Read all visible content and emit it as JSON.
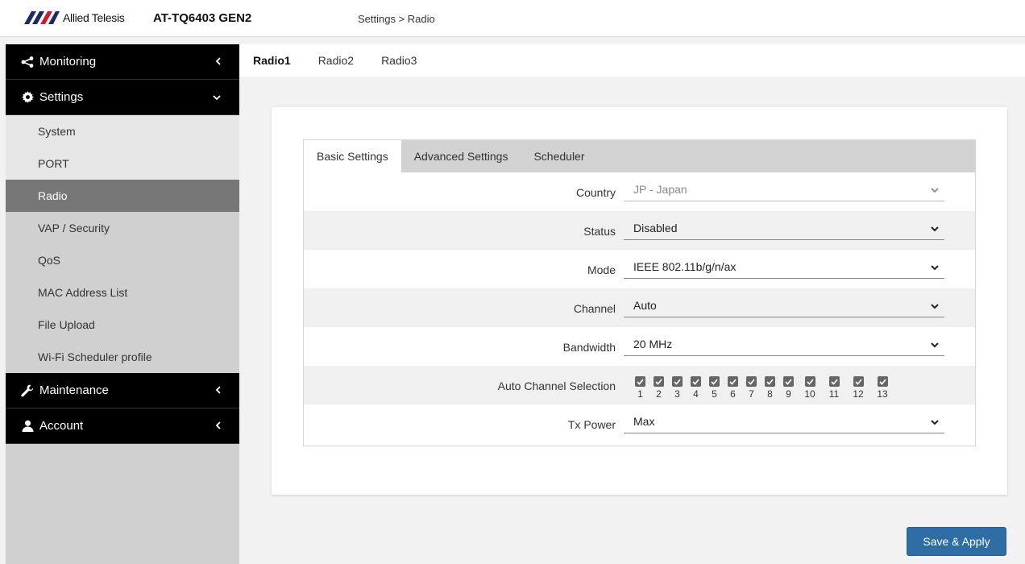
{
  "header": {
    "brand": "Allied Telesis",
    "model": "AT-TQ6403 GEN2",
    "breadcrumb": "Settings > Radio"
  },
  "sidebar": {
    "groups": [
      {
        "label": "Monitoring",
        "icon": "share-icon",
        "state": "collapsed"
      },
      {
        "label": "Settings",
        "icon": "gear-icon",
        "state": "expanded"
      },
      {
        "label": "Maintenance",
        "icon": "wrench-icon",
        "state": "collapsed"
      },
      {
        "label": "Account",
        "icon": "user-icon",
        "state": "collapsed"
      }
    ],
    "settings_items": [
      {
        "label": "System"
      },
      {
        "label": "PORT"
      },
      {
        "label": "Radio"
      },
      {
        "label": "VAP / Security"
      },
      {
        "label": "QoS"
      },
      {
        "label": "MAC Address List"
      },
      {
        "label": "File Upload"
      },
      {
        "label": "Wi-Fi Scheduler profile"
      }
    ],
    "active_item": "Radio"
  },
  "radio_tabs": [
    "Radio1",
    "Radio2",
    "Radio3"
  ],
  "active_radio_tab": "Radio1",
  "sub_tabs": [
    "Basic Settings",
    "Advanced Settings",
    "Scheduler"
  ],
  "active_sub_tab": "Basic Settings",
  "form": {
    "country": {
      "label": "Country",
      "value": "JP - Japan",
      "disabled": true
    },
    "status": {
      "label": "Status",
      "value": "Disabled"
    },
    "mode": {
      "label": "Mode",
      "value": "IEEE 802.11b/g/n/ax"
    },
    "channel": {
      "label": "Channel",
      "value": "Auto"
    },
    "bandwidth": {
      "label": "Bandwidth",
      "value": "20 MHz"
    },
    "auto_channel": {
      "label": "Auto Channel Selection",
      "channels": [
        "1",
        "2",
        "3",
        "4",
        "5",
        "6",
        "7",
        "8",
        "9",
        "10",
        "11",
        "12",
        "13"
      ],
      "checked": [
        true,
        true,
        true,
        true,
        true,
        true,
        true,
        true,
        true,
        true,
        true,
        true,
        true
      ]
    },
    "tx_power": {
      "label": "Tx Power",
      "value": "Max"
    }
  },
  "save_label": "Save & Apply",
  "colors": {
    "nav_bg": "#000000",
    "active_item_bg": "#777777",
    "save_button": "#2e6da4",
    "brand_red": "#cc1f2d",
    "brand_navy": "#1d2a63"
  }
}
